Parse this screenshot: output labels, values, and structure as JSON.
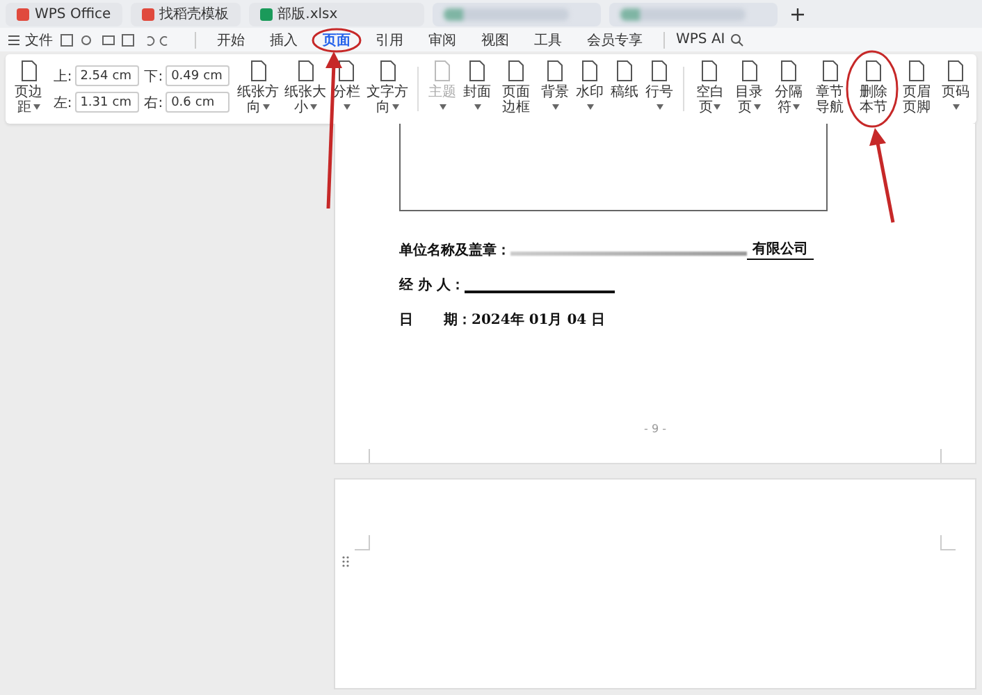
{
  "title_tabs": [
    {
      "kind": "app",
      "label": "WPS Office"
    },
    {
      "kind": "doc",
      "label": "找稻壳模板"
    },
    {
      "kind": "sheet",
      "label": "部版.xlsx"
    },
    {
      "kind": "blurred"
    },
    {
      "kind": "blurred"
    }
  ],
  "menu": {
    "file": "文件",
    "tabs": [
      {
        "label": "开始",
        "selected": false
      },
      {
        "label": "插入",
        "selected": false
      },
      {
        "label": "页面",
        "selected": true
      },
      {
        "label": "引用",
        "selected": false
      },
      {
        "label": "审阅",
        "selected": false
      },
      {
        "label": "视图",
        "selected": false
      },
      {
        "label": "工具",
        "selected": false
      },
      {
        "label": "会员专享",
        "selected": false
      }
    ],
    "ai": "WPS AI"
  },
  "ribbon": {
    "margins_button": {
      "label": "页边距",
      "dropdown": true
    },
    "margins": [
      {
        "label": "上:",
        "value": "2.54",
        "unit": "cm"
      },
      {
        "label": "下:",
        "value": "0.49",
        "unit": "cm"
      },
      {
        "label": "左:",
        "value": "1.31",
        "unit": "cm"
      },
      {
        "label": "右:",
        "value": "0.6",
        "unit": "cm"
      }
    ],
    "groups": [
      [
        {
          "label": "纸张方向",
          "dropdown": true,
          "disabled": false
        },
        {
          "label": "纸张大小",
          "dropdown": true,
          "disabled": false
        },
        {
          "label": "分栏",
          "dropdown": true,
          "disabled": false
        },
        {
          "label": "文字方向",
          "dropdown": true,
          "disabled": false
        }
      ],
      [
        {
          "label": "主题",
          "dropdown": true,
          "disabled": true
        },
        {
          "label": "封面",
          "dropdown": true,
          "disabled": false
        },
        {
          "label": "页面边框",
          "dropdown": false,
          "disabled": false
        },
        {
          "label": "背景",
          "dropdown": true,
          "disabled": false
        },
        {
          "label": "水印",
          "dropdown": true,
          "disabled": false
        },
        {
          "label": "稿纸",
          "dropdown": false,
          "disabled": false
        },
        {
          "label": "行号",
          "dropdown": true,
          "disabled": false
        }
      ],
      [
        {
          "label": "空白页",
          "dropdown": true,
          "disabled": false
        },
        {
          "label": "目录页",
          "dropdown": true,
          "disabled": false
        },
        {
          "label": "分隔符",
          "dropdown": true,
          "disabled": false
        },
        {
          "label": "章节导航",
          "dropdown": false,
          "disabled": false
        },
        {
          "label": "删除本节",
          "dropdown": false,
          "disabled": false
        },
        {
          "label": "页眉页脚",
          "dropdown": false,
          "disabled": false
        },
        {
          "label": "页码",
          "dropdown": true,
          "disabled": false
        }
      ]
    ]
  },
  "document": {
    "fields": [
      {
        "kind": "redacted",
        "label": "单位名称及盖章：",
        "value": "有限公司"
      },
      {
        "kind": "blank",
        "label": "经 办 人："
      },
      {
        "kind": "date",
        "label": "日",
        "label2": "期：2024年 01月 04 日"
      }
    ],
    "page_number": "- 9 -"
  }
}
